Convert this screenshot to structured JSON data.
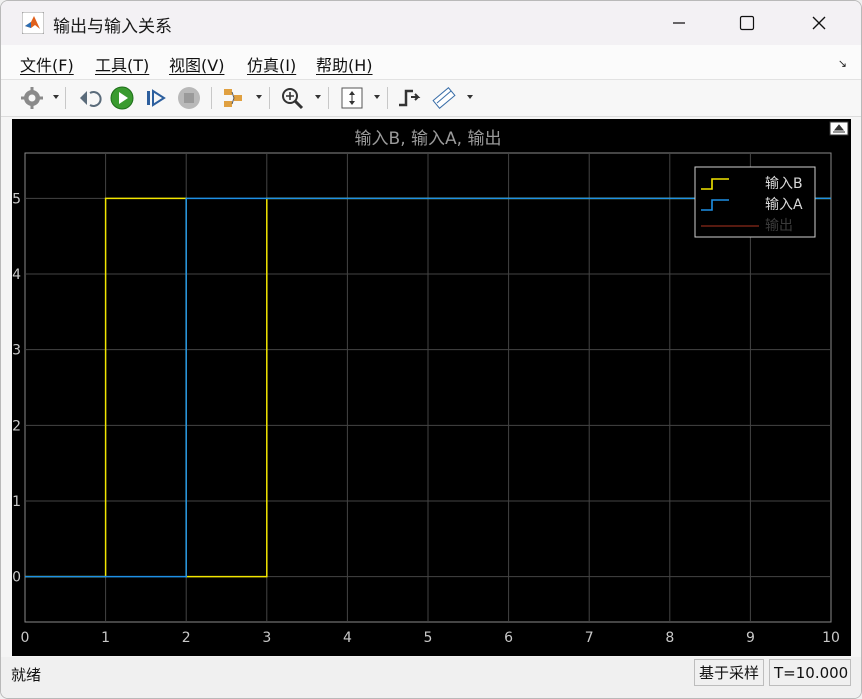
{
  "window": {
    "title": "输出与输入关系"
  },
  "menu": {
    "items": [
      "文件(F)",
      "工具(T)",
      "视图(V)",
      "仿真(I)",
      "帮助(H)"
    ]
  },
  "toolbar": {
    "icons": [
      "gear-icon",
      "step-back-icon",
      "run-icon",
      "step-forward-icon",
      "stop-icon",
      "signal-select-icon",
      "zoom-in-icon",
      "fit-axes-icon",
      "triggers-icon",
      "measure-icon"
    ]
  },
  "colors": {
    "background": "#000000",
    "grid": "#444444",
    "axis_text": "#c8c8c8",
    "series_b": "#f2e600",
    "series_a": "#1e90e6",
    "series_out": "#8b2a1a"
  },
  "chart_data": {
    "type": "line",
    "title": "输入B, 输入A, 输出",
    "xlabel": "",
    "ylabel": "",
    "xlim": [
      0,
      10
    ],
    "ylim": [
      -0.6,
      5.6
    ],
    "xticks": [
      "0",
      "1",
      "2",
      "3",
      "4",
      "5",
      "6",
      "7",
      "8",
      "9",
      "10"
    ],
    "yticks": [
      "0",
      "1",
      "2",
      "3",
      "4",
      "5"
    ],
    "grid": true,
    "legend_position": "top-right",
    "series": [
      {
        "name": "输入B",
        "color": "#f2e600",
        "step": true,
        "x": [
          0,
          1,
          1,
          2,
          2,
          3,
          3,
          10
        ],
        "y": [
          0,
          0,
          5,
          5,
          0,
          0,
          5,
          5
        ]
      },
      {
        "name": "输入A",
        "color": "#1e90e6",
        "step": true,
        "x": [
          0,
          2,
          2,
          10
        ],
        "y": [
          0,
          0,
          5,
          5
        ]
      },
      {
        "name": "输出",
        "color": "#8b2a1a",
        "step": false,
        "x": [],
        "y": []
      }
    ]
  },
  "status": {
    "text": "就绪",
    "mode": "基于采样",
    "time": "T=10.000"
  }
}
